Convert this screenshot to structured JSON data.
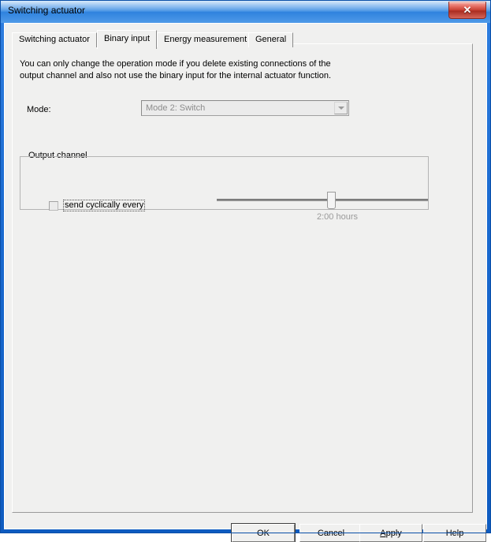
{
  "window": {
    "title": "Switching actuator",
    "close_label": "✕"
  },
  "tabs": [
    {
      "label": "Switching actuator",
      "selected": false
    },
    {
      "label": "Binary input",
      "selected": true
    },
    {
      "label": "Energy measurement",
      "selected": false
    },
    {
      "label": "General",
      "selected": false
    }
  ],
  "page": {
    "description_line1": "You can only change the operation mode if you delete existing connections of the",
    "description_line2": "output channel and also not use the binary input for the internal actuator function.",
    "mode": {
      "label": "Mode:",
      "value": "Mode 2: Switch",
      "enabled": false
    },
    "output_channel": {
      "title": "Output channel",
      "checkbox_label": "send cyclically every",
      "checked": false,
      "slider_value": "2:00 hours"
    }
  },
  "buttons": {
    "ok": "OK",
    "cancel": "Cancel",
    "apply_prefix": "A",
    "apply_rest": "pply",
    "help": "Help"
  },
  "colors": {
    "titlebar_blue": "#3f8fe3",
    "close_red": "#c33c2e",
    "dialog_face": "#f0f0ef",
    "disabled_text": "#8c8c8c"
  }
}
